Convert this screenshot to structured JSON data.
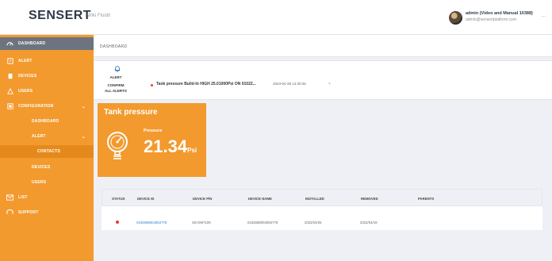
{
  "header": {
    "logo": "SENSERT",
    "site_name": "Wiki Fluidit",
    "user_name": "admin (Video and Manual 10388)",
    "user_email": "admin@sensertplatform.com",
    "menu_glyph": "..."
  },
  "sidebar": {
    "items": [
      {
        "label": "DASHBOARD",
        "icon": "dashboard-icon",
        "active": true
      },
      {
        "label": "ALERT",
        "icon": "alert-icon"
      },
      {
        "label": "DEVICES",
        "icon": "device-icon"
      },
      {
        "label": "USERS",
        "icon": "users-icon"
      },
      {
        "label": "CONFIGURATION",
        "icon": "config-icon",
        "caret": "⌄"
      },
      {
        "label": "DASHBOARD"
      },
      {
        "label": "ALERT",
        "caret": "⌄"
      },
      {
        "label": "CONTACTS"
      },
      {
        "label": "DEVICES"
      },
      {
        "label": "USERS"
      },
      {
        "label": "LIST",
        "icon": "mail-icon"
      },
      {
        "label": "SUPPORT",
        "icon": "support-icon"
      }
    ]
  },
  "breadcrumb": "DASHBOARD",
  "alerts": {
    "header": "ALERT",
    "confirm_line1": "CONFIRM",
    "confirm_line2": "ALL ALERTS",
    "message": "Tank pressure Build-In HIGH 25.01000Psi ON 01022...",
    "timestamp": "2023-04-28 14:30:26",
    "dismiss": "×"
  },
  "widget": {
    "title": "Tank pressure",
    "label": "Pressure",
    "value": "21.34",
    "unit": "Psi",
    "icon": "pressure-gauge-icon"
  },
  "device_table": {
    "columns": [
      "STATUS",
      "DEVICE ID",
      "DEVICE P/N",
      "DEVICE NAME",
      "INSTALLED",
      "REMOVED",
      "PARENTS"
    ],
    "rows": [
      {
        "status": "alarm",
        "device_id": "0102688004053778",
        "device_pn": "SD-DM7109",
        "device_name": "0102688004053778",
        "installed": "2022/04/25",
        "removed": "2022/04/19",
        "parents": ""
      }
    ]
  },
  "colors": {
    "accent": "#f29a2e",
    "sidebar_active": "#6d7480",
    "alert_red": "#e53935",
    "link_blue": "#2f7ed8"
  }
}
